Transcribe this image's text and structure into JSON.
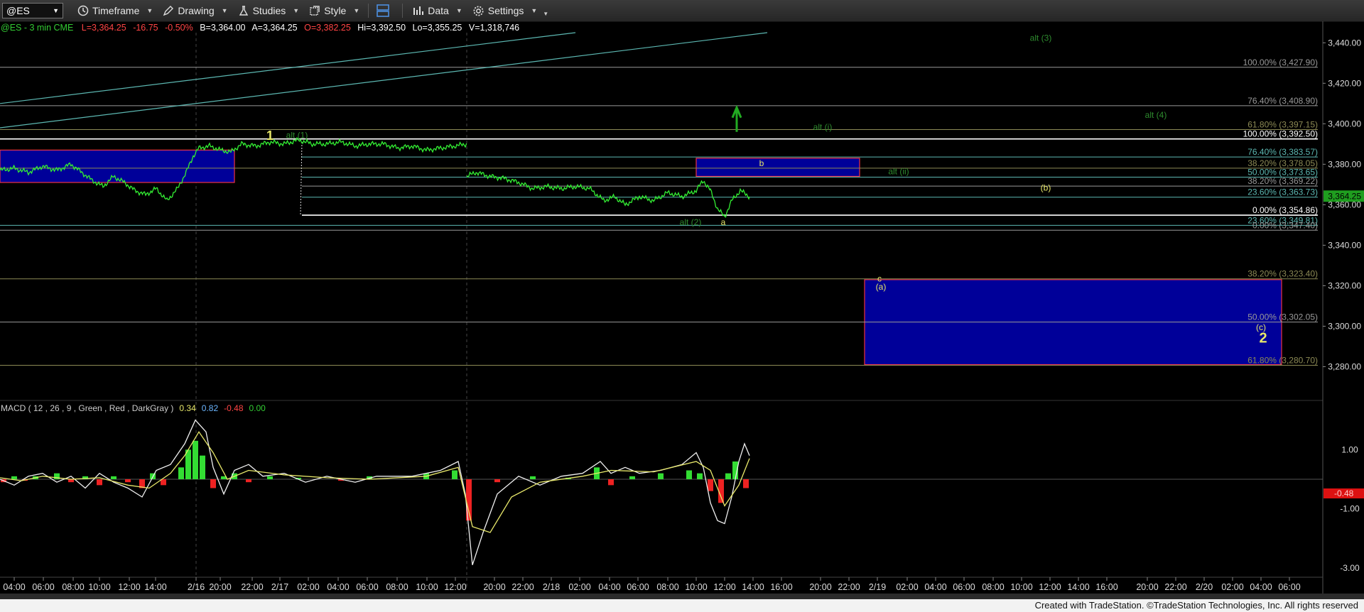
{
  "toolbar": {
    "symbol": "@ES",
    "items": [
      "Timeframe",
      "Drawing",
      "Studies",
      "Style",
      "Data",
      "Settings"
    ]
  },
  "info": {
    "symbol_line": "@ES - 3 min  CME",
    "last": "L=3,364.25",
    "change": "-16.75",
    "change_pct": "-0.50%",
    "bid": "B=3,364.00",
    "ask": "A=3,364.25",
    "open": "O=3,382.25",
    "high": "Hi=3,392.50",
    "low": "Lo=3,355.25",
    "volume": "V=1,318,746"
  },
  "footer": "Created with TradeStation. ©TradeStation Technologies, Inc. All rights reserved",
  "colors": {
    "price": "#33ee33",
    "fib_white": "#ffffff",
    "fib_teal": "#5cb8b2",
    "fib_olive": "#8c8a55",
    "fib_gray": "#999999",
    "box_fill": "#000099",
    "box_edge": "#ee3344",
    "wave_green": "#2e8b2e",
    "wave_yellow": "#e8e86a",
    "last_price": "#1f9e1f",
    "macd_up": "#33dd33",
    "macd_down": "#ee2222"
  },
  "chart_data": {
    "type": "line",
    "title": "@ES - 3 min",
    "y_range": [
      3270,
      3445
    ],
    "y_ticks": [
      "3,440.00",
      "3,420.00",
      "3,400.00",
      "3,380.00",
      "3,360.00",
      "3,340.00",
      "3,320.00",
      "3,300.00",
      "3,280.00"
    ],
    "x_ticks": [
      "04:00",
      "06:00",
      "08:00",
      "10:00",
      "12:00",
      "14:00",
      "2/16",
      "20:00",
      "22:00",
      "2/17",
      "02:00",
      "04:00",
      "06:00",
      "08:00",
      "10:00",
      "12:00",
      "20:00",
      "22:00",
      "2/18",
      "02:00",
      "04:00",
      "06:00",
      "08:00",
      "10:00",
      "12:00",
      "14:00",
      "16:00",
      "20:00",
      "22:00",
      "2/19",
      "02:00",
      "04:00",
      "06:00",
      "08:00",
      "10:00",
      "12:00",
      "14:00",
      "16:00",
      "20:00",
      "22:00",
      "2/20",
      "02:00",
      "04:00",
      "06:00"
    ],
    "last_price": "3,364.25",
    "series": [
      {
        "segment": 1,
        "start_x": 0,
        "end_x": 657,
        "points": [
          [
            0,
            3377
          ],
          [
            20,
            3378
          ],
          [
            40,
            3376
          ],
          [
            60,
            3379
          ],
          [
            80,
            3377
          ],
          [
            100,
            3380
          ],
          [
            115,
            3376
          ],
          [
            130,
            3372
          ],
          [
            145,
            3369
          ],
          [
            160,
            3374
          ],
          [
            175,
            3371
          ],
          [
            190,
            3367
          ],
          [
            205,
            3365
          ],
          [
            220,
            3368
          ],
          [
            235,
            3362
          ],
          [
            250,
            3368
          ],
          [
            262,
            3376
          ],
          [
            272,
            3384
          ],
          [
            280,
            3388
          ],
          [
            295,
            3389
          ],
          [
            310,
            3387
          ],
          [
            325,
            3386
          ],
          [
            340,
            3390
          ],
          [
            360,
            3389
          ],
          [
            380,
            3391
          ],
          [
            400,
            3390
          ],
          [
            420,
            3392
          ],
          [
            440,
            3390
          ],
          [
            460,
            3390
          ],
          [
            480,
            3391
          ],
          [
            500,
            3389
          ],
          [
            520,
            3390
          ],
          [
            540,
            3390
          ],
          [
            560,
            3388
          ],
          [
            580,
            3389
          ],
          [
            600,
            3387
          ],
          [
            620,
            3388
          ],
          [
            640,
            3389
          ],
          [
            657,
            3390
          ]
        ]
      },
      {
        "segment": 2,
        "start_x": 657,
        "end_x": 1055,
        "points": [
          [
            657,
            3374
          ],
          [
            670,
            3376
          ],
          [
            690,
            3374
          ],
          [
            710,
            3373
          ],
          [
            730,
            3371
          ],
          [
            750,
            3368
          ],
          [
            770,
            3369
          ],
          [
            790,
            3368
          ],
          [
            810,
            3369
          ],
          [
            830,
            3368
          ],
          [
            850,
            3362
          ],
          [
            865,
            3364
          ],
          [
            880,
            3360
          ],
          [
            900,
            3364
          ],
          [
            920,
            3362
          ],
          [
            940,
            3366
          ],
          [
            960,
            3364
          ],
          [
            980,
            3367
          ],
          [
            990,
            3372
          ],
          [
            1000,
            3367
          ],
          [
            1010,
            3358
          ],
          [
            1020,
            3354
          ],
          [
            1030,
            3362
          ],
          [
            1042,
            3367
          ],
          [
            1055,
            3364
          ]
        ]
      }
    ],
    "fib_levels": [
      {
        "label": "100.00% (3,427.90)",
        "value": 3427.9,
        "color": "fib_gray",
        "x0": 0
      },
      {
        "label": "76.40% (3,408.90)",
        "value": 3408.9,
        "color": "fib_gray",
        "x0": 0
      },
      {
        "label": "61.80% (3,397.15)",
        "value": 3397.15,
        "color": "fib_olive",
        "x0": 0
      },
      {
        "label": "100.00% (3,392.50)",
        "value": 3392.5,
        "color": "fib_white",
        "x0": 0
      },
      {
        "label": "76.40% (3,383.57)",
        "value": 3383.57,
        "color": "fib_teal",
        "x0": 425
      },
      {
        "label": "38.20% (3,378.05)",
        "value": 3378.05,
        "color": "fib_olive",
        "x0": 0
      },
      {
        "label": "50.00% (3,373.65)",
        "value": 3373.65,
        "color": "fib_teal",
        "x0": 425
      },
      {
        "label": "38.20% (3,369.22)",
        "value": 3369.22,
        "color": "fib_gray",
        "x0": 425
      },
      {
        "label": "23.60% (3,363.73)",
        "value": 3363.73,
        "color": "fib_teal",
        "x0": 425
      },
      {
        "label": "0.00% (3,354.86)",
        "value": 3354.86,
        "color": "fib_white",
        "x0": 425
      },
      {
        "label": "23.60% (3,349.81)",
        "value": 3349.81,
        "color": "fib_teal",
        "x0": 0
      },
      {
        "label": "0.00% (3,347.40)",
        "value": 3347.4,
        "color": "fib_gray",
        "x0": 0
      },
      {
        "label": "38.20% (3,323.40)",
        "value": 3323.4,
        "color": "fib_olive",
        "x0": 0
      },
      {
        "label": "50.00% (3,302.05)",
        "value": 3302.05,
        "color": "fib_gray",
        "x0": 0
      },
      {
        "label": "61.80% (3,280.70)",
        "value": 3280.7,
        "color": "fib_olive",
        "x0": 0
      }
    ],
    "boxes": [
      {
        "x0": 0,
        "x1": 330,
        "top": 3387,
        "bottom": 3371
      },
      {
        "x0": 980,
        "x1": 1210,
        "top": 3383,
        "bottom": 3374
      },
      {
        "x0": 1217,
        "x1": 1804,
        "top": 3323,
        "bottom": 3281
      }
    ],
    "trendlines": [
      {
        "x0": 0,
        "y0": 3410,
        "x1": 810,
        "y1": 3445
      },
      {
        "x0": 0,
        "y0": 3398,
        "x1": 1080,
        "y1": 3445
      }
    ],
    "annotations": [
      {
        "text": "1",
        "x": 380,
        "y": 3392,
        "color": "wave_yellow",
        "size": 18,
        "bold": true
      },
      {
        "text": "alt (1)",
        "x": 418,
        "y": 3393,
        "color": "wave_green",
        "size": 12
      },
      {
        "text": "alt (3)",
        "x": 1465,
        "y": 3441,
        "color": "wave_green",
        "size": 12
      },
      {
        "text": "alt (4)",
        "x": 1627,
        "y": 3403,
        "color": "wave_green",
        "size": 12
      },
      {
        "text": "alt (i)",
        "x": 1158,
        "y": 3397,
        "color": "wave_green",
        "size": 12
      },
      {
        "text": "b",
        "x": 1072,
        "y": 3379,
        "color": "wave_yellow",
        "size": 12
      },
      {
        "text": "alt (ii)",
        "x": 1265,
        "y": 3375,
        "color": "wave_green",
        "size": 12
      },
      {
        "text": "(b)",
        "x": 1472,
        "y": 3367,
        "color": "wave_yellow",
        "size": 12
      },
      {
        "text": "alt (2)",
        "x": 972,
        "y": 3350,
        "color": "wave_green",
        "size": 12
      },
      {
        "text": "a",
        "x": 1018,
        "y": 3350,
        "color": "wave_yellow",
        "size": 12
      },
      {
        "text": "c",
        "x": 1238,
        "y": 3322,
        "color": "wave_yellow",
        "size": 12
      },
      {
        "text": "(a)",
        "x": 1240,
        "y": 3318,
        "color": "wave_yellow",
        "size": 12
      },
      {
        "text": "(c)",
        "x": 1775,
        "y": 3298,
        "color": "wave_yellow",
        "size": 12
      },
      {
        "text": "2",
        "x": 1778,
        "y": 3292,
        "color": "wave_yellow",
        "size": 20,
        "bold": true
      }
    ],
    "macd": {
      "label": "MACD ( 12 , 26 , 9 , Green , Red , DarkGray )",
      "values": [
        "0.34",
        "0.82",
        "-0.48",
        "0.00"
      ],
      "value_colors": [
        "#e8e86a",
        "#6cb6ff",
        "#ff4444",
        "#33cc33"
      ],
      "y_ticks": [
        "1.00",
        "-1.00",
        "-3.00"
      ],
      "last": "-0.48",
      "hist": [
        [
          5,
          -0.1
        ],
        [
          20,
          0.1
        ],
        [
          35,
          -0.05
        ],
        [
          50,
          0.1
        ],
        [
          80,
          0.2
        ],
        [
          100,
          -0.1
        ],
        [
          120,
          0.1
        ],
        [
          140,
          -0.2
        ],
        [
          160,
          0.1
        ],
        [
          180,
          -0.1
        ],
        [
          200,
          -0.3
        ],
        [
          215,
          0.2
        ],
        [
          230,
          -0.2
        ],
        [
          255,
          0.4
        ],
        [
          265,
          1.0
        ],
        [
          275,
          1.3
        ],
        [
          285,
          0.8
        ],
        [
          300,
          -0.3
        ],
        [
          315,
          0.1
        ],
        [
          330,
          0.2
        ],
        [
          350,
          -0.1
        ],
        [
          380,
          0.1
        ],
        [
          420,
          0.05
        ],
        [
          480,
          -0.05
        ],
        [
          520,
          0.1
        ],
        [
          600,
          0.2
        ],
        [
          640,
          0.3
        ],
        [
          660,
          -1.4
        ],
        [
          700,
          -0.1
        ],
        [
          750,
          0.1
        ],
        [
          800,
          0.05
        ],
        [
          840,
          0.4
        ],
        [
          860,
          -0.2
        ],
        [
          890,
          0.1
        ],
        [
          930,
          0.2
        ],
        [
          970,
          0.3
        ],
        [
          985,
          0.2
        ],
        [
          1000,
          -0.4
        ],
        [
          1015,
          -0.8
        ],
        [
          1025,
          0.2
        ],
        [
          1035,
          0.6
        ],
        [
          1050,
          -0.3
        ]
      ],
      "macd_line": [
        [
          0,
          0
        ],
        [
          20,
          -0.2
        ],
        [
          40,
          0.1
        ],
        [
          60,
          0.2
        ],
        [
          80,
          -0.1
        ],
        [
          100,
          0.1
        ],
        [
          120,
          -0.3
        ],
        [
          140,
          0.2
        ],
        [
          160,
          -0.1
        ],
        [
          180,
          -0.3
        ],
        [
          200,
          -0.6
        ],
        [
          220,
          0.3
        ],
        [
          240,
          0.5
        ],
        [
          260,
          1.2
        ],
        [
          275,
          2.0
        ],
        [
          290,
          1.6
        ],
        [
          300,
          0.4
        ],
        [
          315,
          -0.5
        ],
        [
          330,
          0.3
        ],
        [
          350,
          0.5
        ],
        [
          370,
          0.1
        ],
        [
          400,
          0.2
        ],
        [
          430,
          -0.1
        ],
        [
          460,
          0.1
        ],
        [
          500,
          -0.1
        ],
        [
          530,
          0.1
        ],
        [
          580,
          0.1
        ],
        [
          620,
          0.3
        ],
        [
          645,
          0.6
        ],
        [
          655,
          -0.5
        ],
        [
          665,
          -2.9
        ],
        [
          680,
          -1.8
        ],
        [
          700,
          -0.5
        ],
        [
          730,
          0.1
        ],
        [
          760,
          -0.2
        ],
        [
          790,
          0.1
        ],
        [
          820,
          0.2
        ],
        [
          845,
          0.6
        ],
        [
          860,
          0.2
        ],
        [
          880,
          0.4
        ],
        [
          900,
          0.2
        ],
        [
          930,
          0.3
        ],
        [
          960,
          0.5
        ],
        [
          980,
          0.9
        ],
        [
          990,
          0.4
        ],
        [
          1000,
          -0.8
        ],
        [
          1010,
          -1.4
        ],
        [
          1020,
          -1.5
        ],
        [
          1030,
          -0.6
        ],
        [
          1040,
          0.6
        ],
        [
          1048,
          1.2
        ],
        [
          1055,
          0.8
        ]
      ],
      "signal_line": [
        [
          0,
          0.05
        ],
        [
          30,
          -0.05
        ],
        [
          60,
          0.1
        ],
        [
          100,
          0.0
        ],
        [
          140,
          0.05
        ],
        [
          180,
          -0.2
        ],
        [
          210,
          -0.3
        ],
        [
          240,
          0.2
        ],
        [
          260,
          0.8
        ],
        [
          280,
          1.6
        ],
        [
          300,
          0.9
        ],
        [
          320,
          0.0
        ],
        [
          350,
          0.3
        ],
        [
          400,
          0.15
        ],
        [
          460,
          0.05
        ],
        [
          520,
          0.0
        ],
        [
          600,
          0.1
        ],
        [
          645,
          0.4
        ],
        [
          665,
          -1.6
        ],
        [
          690,
          -1.8
        ],
        [
          720,
          -0.6
        ],
        [
          760,
          -0.1
        ],
        [
          820,
          0.1
        ],
        [
          860,
          0.3
        ],
        [
          920,
          0.25
        ],
        [
          980,
          0.6
        ],
        [
          1000,
          0.3
        ],
        [
          1020,
          -0.9
        ],
        [
          1040,
          -0.2
        ],
        [
          1055,
          0.7
        ]
      ]
    }
  }
}
